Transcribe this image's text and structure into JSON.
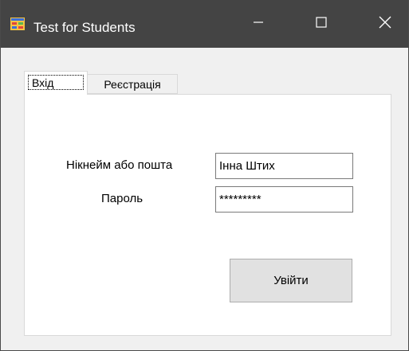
{
  "window": {
    "title": "Test for Students",
    "app_icon": "app-form-icon",
    "controls": {
      "minimize_icon": "minimize-icon",
      "maximize_icon": "maximize-icon",
      "close_icon": "close-icon"
    }
  },
  "tabs": [
    {
      "label": "Вхід",
      "selected": true
    },
    {
      "label": "Реєстрація",
      "selected": false
    }
  ],
  "form": {
    "nickname_label": "Нікнейм або пошта",
    "nickname_value": "Інна Штих",
    "password_label": "Пароль",
    "password_value": "*********",
    "submit_label": "Увійти"
  },
  "colors": {
    "titlebar": "#444444",
    "window_bg": "#f0f0f0",
    "button_bg": "#e1e1e1"
  }
}
